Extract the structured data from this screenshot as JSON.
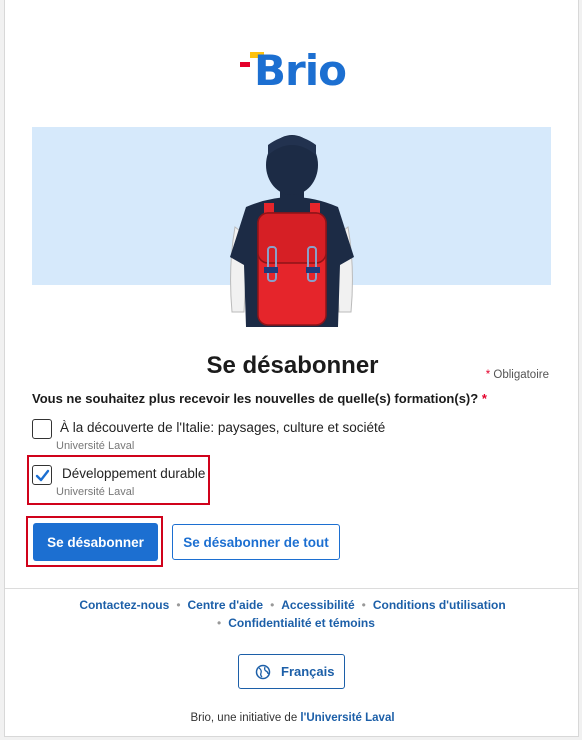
{
  "brand": {
    "logo_text": "Brio",
    "accent": "#1c6fd1",
    "red": "#e4002b",
    "yellow": "#ffc20e"
  },
  "page": {
    "title": "Se désabonner",
    "required_note": "Obligatoire",
    "required_star": "*",
    "question": "Vous ne souhaitez plus recevoir les nouvelles de quelle(s) formation(s)?",
    "options": [
      {
        "title": "À la découverte de l'Italie: paysages, culture et société",
        "institution": "Université Laval",
        "checked": false
      },
      {
        "title": "Développement durable",
        "institution": "Université Laval",
        "checked": true
      }
    ],
    "unsubscribe_button": "Se désabonner",
    "unsubscribe_all_button": "Se désabonner de tout"
  },
  "footer": {
    "links": [
      "Contactez-nous",
      "Centre d'aide",
      "Accessibilité",
      "Conditions d'utilisation",
      "Confidentialité et témoins"
    ],
    "separator": "•",
    "language_button": "Français",
    "credit_prefix": "Brio, une initiative de ",
    "credit_link": "l'Université Laval"
  }
}
